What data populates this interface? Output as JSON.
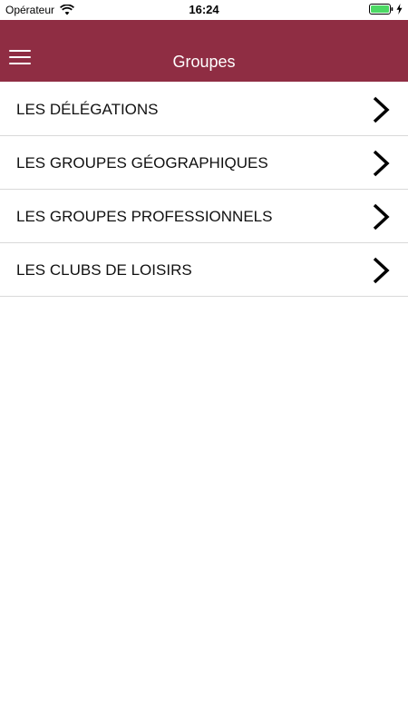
{
  "status_bar": {
    "carrier": "Opérateur",
    "time": "16:24"
  },
  "header": {
    "title": "Groupes"
  },
  "colors": {
    "header_bg": "#8f2d43",
    "battery": "#4cd964"
  },
  "list": {
    "items": [
      {
        "label": "LES DÉLÉGATIONS"
      },
      {
        "label": "LES GROUPES GÉOGRAPHIQUES"
      },
      {
        "label": "LES GROUPES PROFESSIONNELS"
      },
      {
        "label": "LES CLUBS DE LOISIRS"
      }
    ]
  }
}
